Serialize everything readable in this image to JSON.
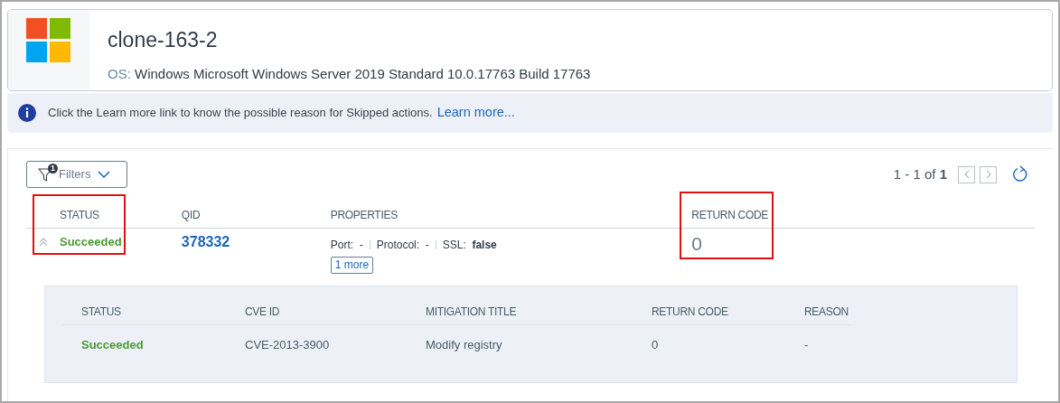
{
  "host": {
    "name": "clone-163-2",
    "os_label": "OS:",
    "os_value": "Windows Microsoft Windows Server 2019 Standard 10.0.17763 Build 17763"
  },
  "banner": {
    "text": "Click the Learn more link to know the possible reason for Skipped actions.",
    "link": "Learn more..."
  },
  "filters": {
    "label": "Filters",
    "count": "1"
  },
  "pagination": {
    "range": "1 - 1 of",
    "total": "1"
  },
  "columns": [
    {
      "label": "STATUS",
      "highlighted": true
    },
    {
      "label": "QID",
      "highlighted": false
    },
    {
      "label": "PROPERTIES",
      "highlighted": false
    },
    {
      "label": "RETURN CODE",
      "highlighted": true
    }
  ],
  "row": {
    "expanded": true,
    "status": "Succeeded",
    "qid": "378332",
    "properties": [
      {
        "name": "Port:",
        "value": "-"
      },
      {
        "name": "Protocol:",
        "value": "-"
      },
      {
        "name": "SSL:",
        "value": "false"
      }
    ],
    "more": "1 more",
    "return_code": "0"
  },
  "details": {
    "columns": [
      "STATUS",
      "CVE ID",
      "MITIGATION TITLE",
      "RETURN CODE",
      "REASON"
    ],
    "rows": [
      [
        "Succeeded",
        "CVE-2013-3900",
        "Modify registry",
        "0",
        "-"
      ]
    ]
  }
}
